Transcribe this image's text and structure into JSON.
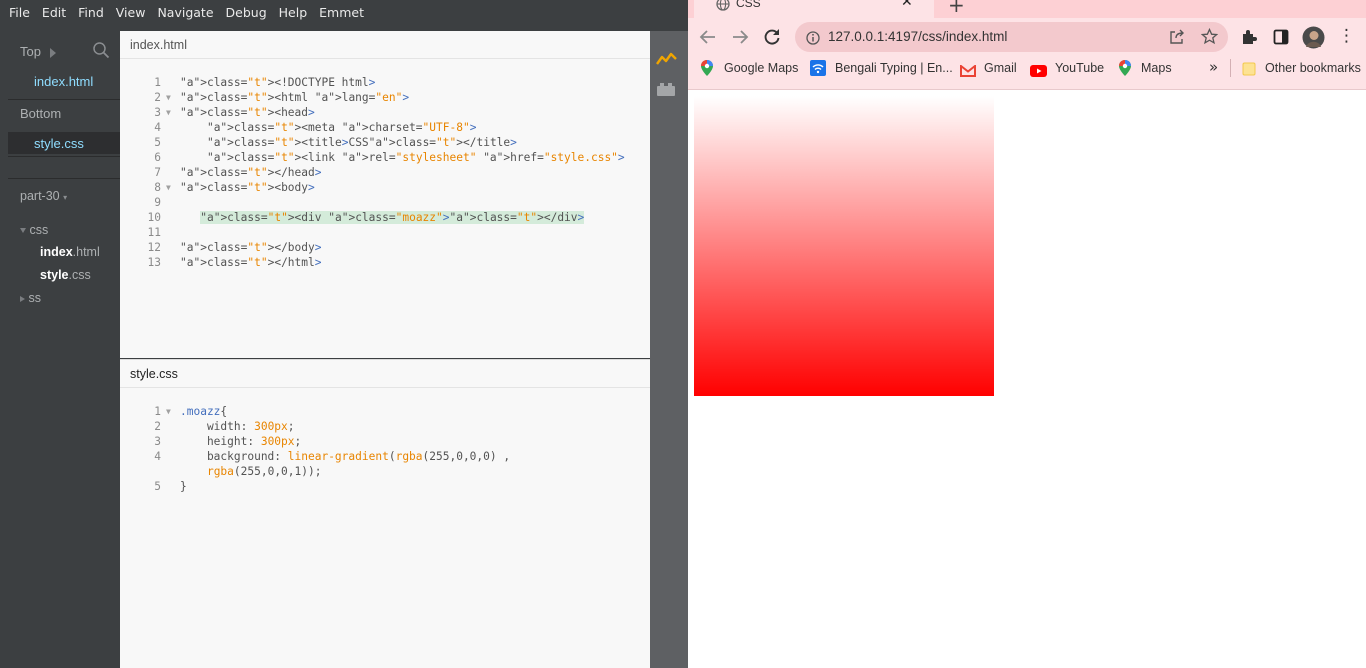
{
  "editor": {
    "menu": [
      "File",
      "Edit",
      "Find",
      "View",
      "Navigate",
      "Debug",
      "Help",
      "Emmet"
    ],
    "sidebar": {
      "top_label": "Top",
      "top_file": "index.html",
      "bottom_label": "Bottom",
      "bottom_file": "style.css",
      "project_name": "part-30",
      "tree": {
        "folder_css": "css",
        "file1_name": "index",
        "file1_ext": ".html",
        "file2_name": "style",
        "file2_ext": ".css",
        "folder_ss": "ss"
      }
    },
    "pane1": {
      "title": "index.html",
      "lines": [
        {
          "n": "1",
          "fold": "",
          "code": "<!DOCTYPE html>"
        },
        {
          "n": "2",
          "fold": "▼",
          "code": "<html lang=\"en\">"
        },
        {
          "n": "3",
          "fold": "▼",
          "code": "<head>"
        },
        {
          "n": "4",
          "fold": "",
          "code": "    <meta charset=\"UTF-8\">"
        },
        {
          "n": "5",
          "fold": "",
          "code": "    <title>CSS</title>"
        },
        {
          "n": "6",
          "fold": "",
          "code": "    <link rel=\"stylesheet\" href=\"style.css\">"
        },
        {
          "n": "7",
          "fold": "",
          "code": "</head>"
        },
        {
          "n": "8",
          "fold": "▼",
          "code": "<body>"
        },
        {
          "n": "9",
          "fold": "",
          "code": ""
        },
        {
          "n": "10",
          "fold": "",
          "code": "   <div class=\"moazz\"></div>"
        },
        {
          "n": "11",
          "fold": "",
          "code": ""
        },
        {
          "n": "12",
          "fold": "",
          "code": "</body>"
        },
        {
          "n": "13",
          "fold": "",
          "code": "</html>"
        }
      ]
    },
    "pane2": {
      "title": "style.css",
      "lines": [
        {
          "n": "1",
          "fold": "▼",
          "code": ".moazz{"
        },
        {
          "n": "2",
          "fold": "",
          "code": "    width: 300px;"
        },
        {
          "n": "3",
          "fold": "",
          "code": "    height: 300px;"
        },
        {
          "n": "4",
          "fold": "",
          "code": "    background: linear-gradient(rgba(255,0,0,0) ,"
        },
        {
          "n": "",
          "fold": "",
          "code": "    rgba(255,0,0,1));"
        },
        {
          "n": "5",
          "fold": "",
          "code": "}"
        }
      ]
    }
  },
  "browser": {
    "tab_title": "CSS",
    "url": "127.0.0.1:4197/css/index.html",
    "bookmarks": [
      "Google Maps",
      "Bengali Typing | En...",
      "Gmail",
      "YouTube",
      "Maps"
    ],
    "other_bookmarks": "Other bookmarks",
    "colors": {
      "tab_strip": "#fdd0d4",
      "toolbar": "#fde3e6",
      "gradient_end": "#ff0000"
    }
  }
}
